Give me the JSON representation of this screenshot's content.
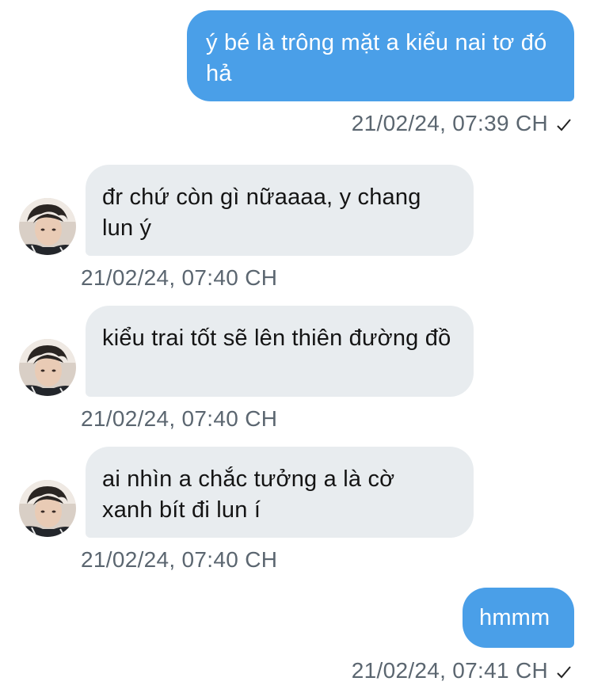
{
  "messages": [
    {
      "direction": "sent",
      "text": "ý bé là trông mặt a kiểu nai tơ đó hả",
      "timestamp": "21/02/24, 07:39 CH",
      "read_icon": "checkmark-icon"
    },
    {
      "direction": "received",
      "text": "đr chứ còn gì nữaaaa, y chang lun ý",
      "timestamp": "21/02/24, 07:40 CH",
      "avatar_icon": "user-avatar"
    },
    {
      "direction": "received",
      "text": "kiểu trai tốt sẽ lên thiên đường đồ",
      "timestamp": "21/02/24, 07:40 CH",
      "avatar_icon": "user-avatar"
    },
    {
      "direction": "received",
      "text": "ai nhìn a chắc tưởng a là cờ xanh bít đi lun í",
      "timestamp": "21/02/24, 07:40 CH",
      "avatar_icon": "user-avatar"
    },
    {
      "direction": "sent",
      "text": "hmmm",
      "timestamp": "21/02/24, 07:41 CH",
      "read_icon": "checkmark-icon"
    }
  ],
  "colors": {
    "sent_bubble": "#4a9fe8",
    "received_bubble": "#e8ecef",
    "timestamp": "#5b6670"
  }
}
